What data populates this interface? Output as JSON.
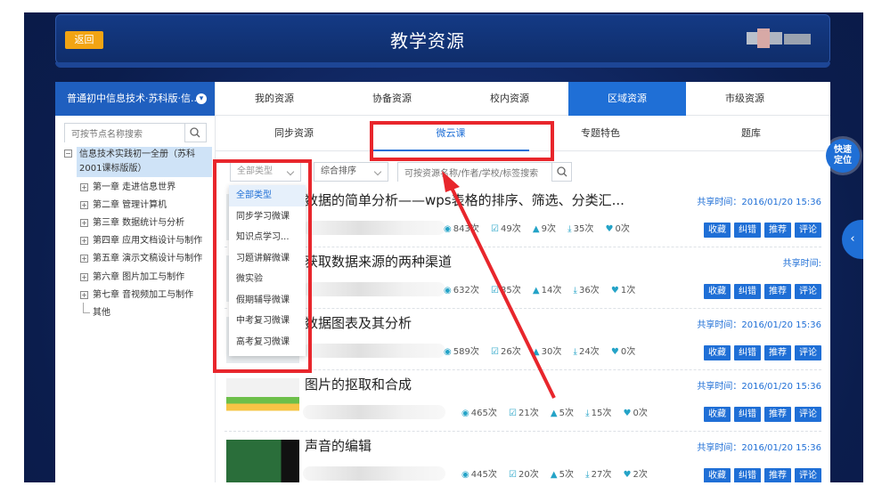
{
  "header": {
    "back_label": "返回",
    "title": "教学资源"
  },
  "tree": {
    "title": "普通初中信息技术·苏科版·信...",
    "search_placeholder": "可按节点名称搜索",
    "root_label": "信息技术实践初一全册（苏科2001课标版版）",
    "chapters": [
      "第一章 走进信息世界",
      "第二章 管理计算机",
      "第三章 数据统计与分析",
      "第四章 应用文档设计与制作",
      "第五章 演示文稿设计与制作",
      "第六章 图片加工与制作",
      "第七章 音视频加工与制作",
      "其他"
    ]
  },
  "tabs_primary": [
    "我的资源",
    "协备资源",
    "校内资源",
    "区域资源",
    "市级资源"
  ],
  "tabs_primary_active": "区域资源",
  "tabs_secondary": [
    "同步资源",
    "微云课",
    "专题特色",
    "题库"
  ],
  "tabs_secondary_active": "微云课",
  "filters": {
    "type_label": "全部类型",
    "sort_label": "综合排序",
    "search_placeholder": "可按资源名称/作者/学校/标签搜索"
  },
  "type_options": [
    "全部类型",
    "同步学习微课",
    "知识点学习...",
    "习题讲解微课",
    "微实验",
    "假期辅导微课",
    "中考复习微课",
    "高考复习微课"
  ],
  "resources": [
    {
      "title": "数据的简单分析——wps表格的排序、筛选、分类汇...",
      "time": "共享时间：2016/01/20 15:36",
      "views": "843次",
      "edits": "49次",
      "likes": "9次",
      "downloads": "35次",
      "hearts": "0次"
    },
    {
      "title": "获取数据来源的两种渠道",
      "time": "共享时间:",
      "views": "632次",
      "edits": "35次",
      "likes": "14次",
      "downloads": "36次",
      "hearts": "1次"
    },
    {
      "title": "数据图表及其分析",
      "time": "共享时间：2016/01/20 15:36",
      "views": "589次",
      "edits": "26次",
      "likes": "30次",
      "downloads": "24次",
      "hearts": "0次"
    },
    {
      "title": "图片的抠取和合成",
      "time": "共享时间：2016/01/20 15:36",
      "views": "465次",
      "edits": "21次",
      "likes": "5次",
      "downloads": "15次",
      "hearts": "0次"
    },
    {
      "title": "声音的编辑",
      "time": "共享时间：2016/01/20 15:36",
      "views": "445次",
      "edits": "20次",
      "likes": "5次",
      "downloads": "27次",
      "hearts": "2次"
    }
  ],
  "actions": [
    "收藏",
    "纠错",
    "推荐",
    "评论"
  ],
  "quick_locate": "快速定位",
  "colors": {
    "accent": "#1f6fd6",
    "header_bg": "#143a85",
    "back_button": "#f2a413",
    "annotation_red": "#e8262c"
  }
}
